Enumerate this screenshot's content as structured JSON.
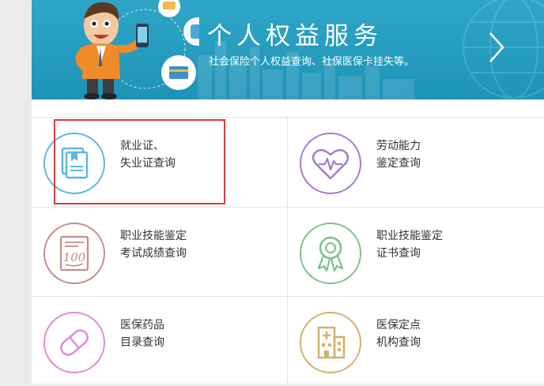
{
  "banner": {
    "title": "个人权益服务",
    "subtitle": "社会保险个人权益查询、社保医保卡挂失等。"
  },
  "services": [
    {
      "line1": "就业证、",
      "line2": "失业证查询",
      "icon": "certificate-book-icon",
      "color": "#5bb8e0"
    },
    {
      "line1": "劳动能力",
      "line2": "鉴定查询",
      "icon": "heart-pulse-icon",
      "color": "#a677d2"
    },
    {
      "line1": "职业技能鉴定",
      "line2": "考试成绩查询",
      "icon": "exam-score-100-icon",
      "color": "#c98b88"
    },
    {
      "line1": "职业技能鉴定",
      "line2": "证书查询",
      "icon": "award-ribbon-icon",
      "color": "#7cc08e"
    },
    {
      "line1": "医保药品",
      "line2": "目录查询",
      "icon": "pill-capsule-icon",
      "color": "#e08bd0"
    },
    {
      "line1": "医保定点",
      "line2": "机构查询",
      "icon": "hospital-building-icon",
      "color": "#d4b06c"
    }
  ]
}
